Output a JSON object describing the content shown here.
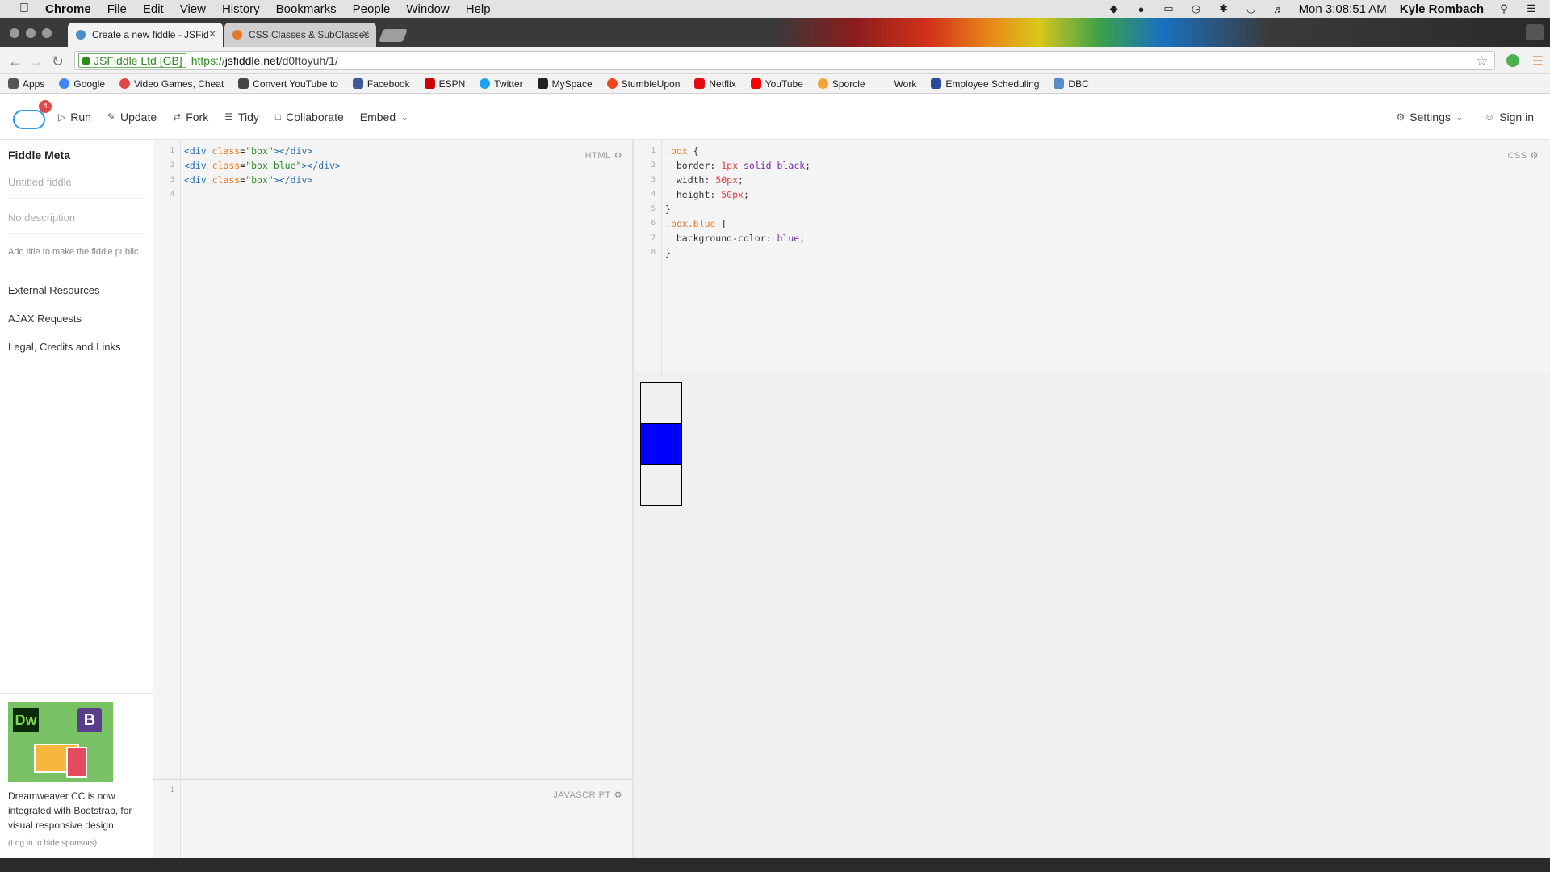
{
  "menubar": {
    "app": "Chrome",
    "items": [
      "File",
      "Edit",
      "View",
      "History",
      "Bookmarks",
      "People",
      "Window",
      "Help"
    ],
    "clock": "Mon 3:08:51 AM",
    "user": "Kyle Rombach"
  },
  "tabs": [
    {
      "title": "Create a new fiddle - JSFid",
      "active": true
    },
    {
      "title": "CSS Classes & SubClasses",
      "active": false
    }
  ],
  "address": {
    "secure_label": "JSFiddle Ltd [GB]",
    "scheme": "https://",
    "host": "jsfiddle.net",
    "path": "/d0ftoyuh/1/"
  },
  "bookmarks": [
    {
      "label": "Apps",
      "color": "#555555"
    },
    {
      "label": "Google",
      "color": "#4285f4"
    },
    {
      "label": "Video Games, Cheat",
      "color": "#e04848"
    },
    {
      "label": "Convert YouTube to",
      "color": "#444444"
    },
    {
      "label": "Facebook",
      "color": "#3b5998"
    },
    {
      "label": "ESPN",
      "color": "#cc0000"
    },
    {
      "label": "Twitter",
      "color": "#1da1f2"
    },
    {
      "label": "MySpace",
      "color": "#222222"
    },
    {
      "label": "StumbleUpon",
      "color": "#eb4924"
    },
    {
      "label": "Netflix",
      "color": "#e50914"
    },
    {
      "label": "YouTube",
      "color": "#ff0000"
    },
    {
      "label": "Sporcle",
      "color": "#f2a33a"
    },
    {
      "label": "Work",
      "color": "#f2f2f2"
    },
    {
      "label": "Employee Scheduling",
      "color": "#2a4a9a"
    },
    {
      "label": "DBC",
      "color": "#5a8ac8"
    }
  ],
  "toolbar": {
    "badge": "4",
    "run": "Run",
    "update": "Update",
    "fork": "Fork",
    "tidy": "Tidy",
    "collaborate": "Collaborate",
    "embed": "Embed",
    "settings": "Settings",
    "signin": "Sign in"
  },
  "sidebar": {
    "title": "Fiddle Meta",
    "title_placeholder": "Untitled fiddle",
    "desc_placeholder": "No description",
    "note": "Add title to make the fiddle public.",
    "links": [
      "External Resources",
      "AJAX Requests",
      "Legal, Credits and Links"
    ],
    "sponsor_dw": "Dw",
    "sponsor_b": "B",
    "sponsor_text": "Dreamweaver CC is now integrated with Bootstrap, for visual responsive design.",
    "sponsor_hide": "(Log in to hide sponsors)"
  },
  "html_panel": {
    "label": "HTML",
    "line_numbers": [
      "1",
      "2",
      "3",
      "4"
    ]
  },
  "css_panel": {
    "label": "CSS",
    "line_numbers": [
      "1",
      "2",
      "3",
      "4",
      "5",
      "6",
      "7",
      "8"
    ]
  },
  "js_panel": {
    "label": "JAVASCRIPT",
    "line_numbers": [
      "1"
    ]
  },
  "result": {
    "boxes": [
      "box",
      "box blue",
      "box"
    ],
    "blue_color": "#0000ff"
  }
}
